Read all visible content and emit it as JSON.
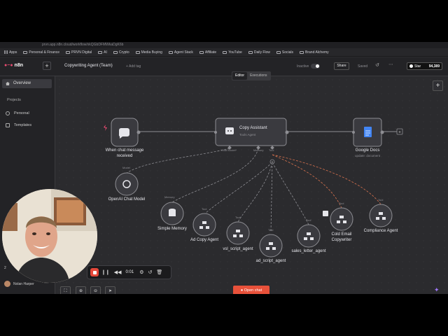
{
  "browser": {
    "url": "prvn.app.n8n.cloud/workflow/xkQGbDFMWkaDgK6b",
    "bookmarks": [
      "Apps",
      "Personal & Finance",
      "PRVN Digital",
      "AI",
      "Crypto",
      "Media Buying",
      "Agent Stack",
      "Affiliate",
      "YouTube",
      "Daily Flow",
      "Socials",
      "Brand Alchemy"
    ]
  },
  "app": {
    "logo": "n8n",
    "workflow_title": "Copywriting Agent (Team)",
    "add_tag": "+ Add tag",
    "inactive_label": "Inactive",
    "share_label": "Share",
    "saved_label": "Saved",
    "star_label": "Star",
    "star_count": "94,389",
    "tabs": [
      {
        "label": "Editor",
        "active": true
      },
      {
        "label": "Executions",
        "active": false
      }
    ]
  },
  "sidebar": {
    "overview": "Overview",
    "projects_header": "Projects",
    "items": [
      {
        "label": "Personal"
      },
      {
        "label": "Templates"
      }
    ],
    "user": "Nolan Harper",
    "count_partial": "2"
  },
  "canvas": {
    "nodes": {
      "trigger": {
        "label": "When chat message",
        "label2": "received"
      },
      "agent": {
        "title": "Copy Assistant",
        "subtitle": "Tools Agent",
        "ports": [
          "Chat Model*",
          "Memory",
          "Tool"
        ]
      },
      "docs": {
        "label": "Google Docs",
        "subtitle": "update: document"
      },
      "openai": {
        "label": "OpenAI Chat Model",
        "port": "Model"
      },
      "memory": {
        "label": "Simple Memory",
        "port": "Memory"
      },
      "tools": [
        {
          "label": "Ad Copy Agent",
          "port": "Tool"
        },
        {
          "label": "vsl_script_agent",
          "port": "Tool"
        },
        {
          "label": "ad_script_agent",
          "port": "Tool"
        },
        {
          "label": "sales_letter_agent",
          "port": "Tool"
        },
        {
          "label": "Cold Email",
          "label2": "Copywriter",
          "port": "Tool"
        },
        {
          "label": "Compliance Agent",
          "port": "Tool"
        }
      ]
    },
    "open_chat": "Open chat"
  },
  "recorder": {
    "time": "0:01"
  },
  "colors": {
    "accent": "#ea4b71",
    "open_chat": "#e8513a",
    "dashed_error": "#d9734f",
    "record": "#e5483a"
  }
}
